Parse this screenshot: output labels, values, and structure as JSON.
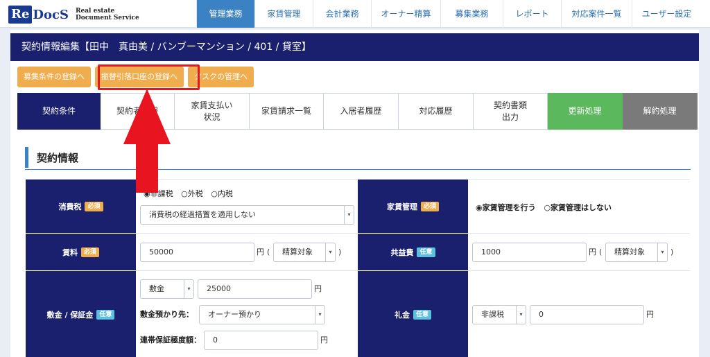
{
  "logo": {
    "mark": "Re",
    "rest": "DocS",
    "sub1": "Real estate",
    "sub2": "Document Service"
  },
  "nav": [
    {
      "label": "管理業務",
      "active": true
    },
    {
      "label": "家賃管理"
    },
    {
      "label": "会計業務"
    },
    {
      "label": "オーナー精算"
    },
    {
      "label": "募集業務"
    },
    {
      "label": "レポート"
    },
    {
      "label": "対応案件一覧"
    },
    {
      "label": "ユーザー設定"
    }
  ],
  "page_title": "契約情報編集【田中　真由美 / バンブーマンション / 401 / 貸室】",
  "subbuttons": [
    "募集条件の登録へ",
    "振替引落口座の登録へ",
    "タスクの管理へ"
  ],
  "tabs": [
    "契約条件",
    "契約者情報",
    "家賃支払い\n状況",
    "家賃請求一覧",
    "入居者履歴",
    "対応履歴",
    "契約書類\n出力",
    "更新処理",
    "解約処理"
  ],
  "section_title": "契約情報",
  "form": {
    "tax_label": "消費税",
    "required": "必須",
    "optional": "任意",
    "tax_radio_1": "◉非課税",
    "tax_radio_2": "○外税",
    "tax_radio_3": "○内税",
    "tax_select": "消費税の経過措置を適用しない",
    "mgmt_label": "家賃管理",
    "mgmt_radio_1": "◉家賃管理を行う",
    "mgmt_radio_2": "○家賃管理はしない",
    "rent_label": "賃料",
    "rent_value": "50000",
    "yen": "円",
    "paren_open": "(",
    "paren_close": ")",
    "settle_select": "精算対象",
    "common_label": "共益費",
    "common_value": "1000",
    "deposit_label": "敷金 / 保証金",
    "deposit_type": "敷金",
    "deposit_value": "25000",
    "deposit_holder_label": "敷金預かり先：",
    "deposit_holder": "オーナー預かり",
    "guarantee_label": "連帯保証極度額：",
    "guarantee_value": "0",
    "keymoney_label": "礼金",
    "keymoney_tax": "非課税",
    "keymoney_value": "0"
  },
  "colors": {
    "nav_active": "#3b82c4",
    "title_bar": "#1a1f6e",
    "orange": "#f0ad4e",
    "green": "#5cb85c",
    "highlight": "#e8141f"
  }
}
